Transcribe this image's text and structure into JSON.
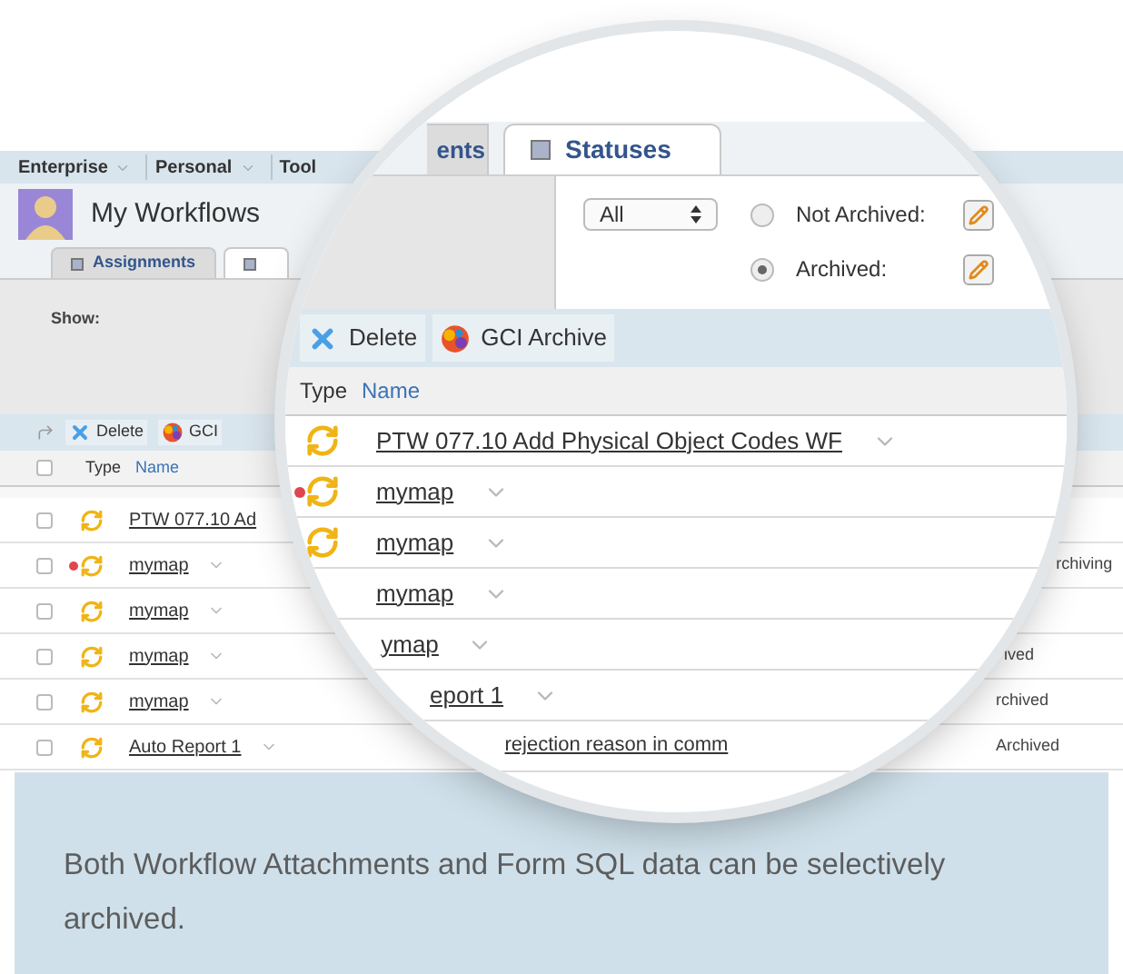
{
  "menu": [
    {
      "label": "Enterprise"
    },
    {
      "label": "Personal"
    },
    {
      "label": "Tool"
    }
  ],
  "page_title": "My Workflows",
  "tabs": [
    {
      "label": "Assignments",
      "selected": false
    },
    {
      "selected": true
    }
  ],
  "show_label": "Show:",
  "toolbar": [
    "Delete",
    "GCI"
  ],
  "columns": [
    "Type",
    "Name"
  ],
  "select_all": {
    "checked": false
  },
  "rows": [
    {
      "name": "PTW 077.10 Ad",
      "checked": false,
      "flagged": false
    },
    {
      "name": "mymap",
      "checked": false,
      "flagged": true,
      "status": "rchiving"
    },
    {
      "name": "mymap",
      "checked": false,
      "flagged": false
    },
    {
      "name": "mymap",
      "checked": false,
      "flagged": false,
      "status": "ived"
    },
    {
      "name": "mymap",
      "checked": false,
      "flagged": false,
      "status": "rchived"
    },
    {
      "name": "Auto Report 1",
      "checked": false,
      "flagged": false,
      "status": "Archived"
    }
  ],
  "magnifier": {
    "tabs": [
      {
        "label": "ents",
        "selected": false
      },
      {
        "label": "Statuses",
        "selected": true
      }
    ],
    "filter_select": "All",
    "radios": [
      {
        "label": "Not Archived:",
        "selected": false
      },
      {
        "label": "Archived:",
        "selected": true
      }
    ],
    "toolbar": [
      "Delete",
      "GCI Archive"
    ],
    "columns": [
      "Type",
      "Name"
    ],
    "rows": [
      {
        "name": "PTW 077.10 Add Physical Object Codes WF",
        "flagged": false
      },
      {
        "name": "mymap",
        "flagged": true
      },
      {
        "name": "mymap",
        "flagged": false
      },
      {
        "name": "mymap"
      },
      {
        "name": "ymap"
      },
      {
        "name": "eport 1"
      },
      {
        "name": "rejection reason in comm"
      }
    ]
  },
  "caption": "Both Workflow Attachments and Form SQL data can be selectively archived."
}
